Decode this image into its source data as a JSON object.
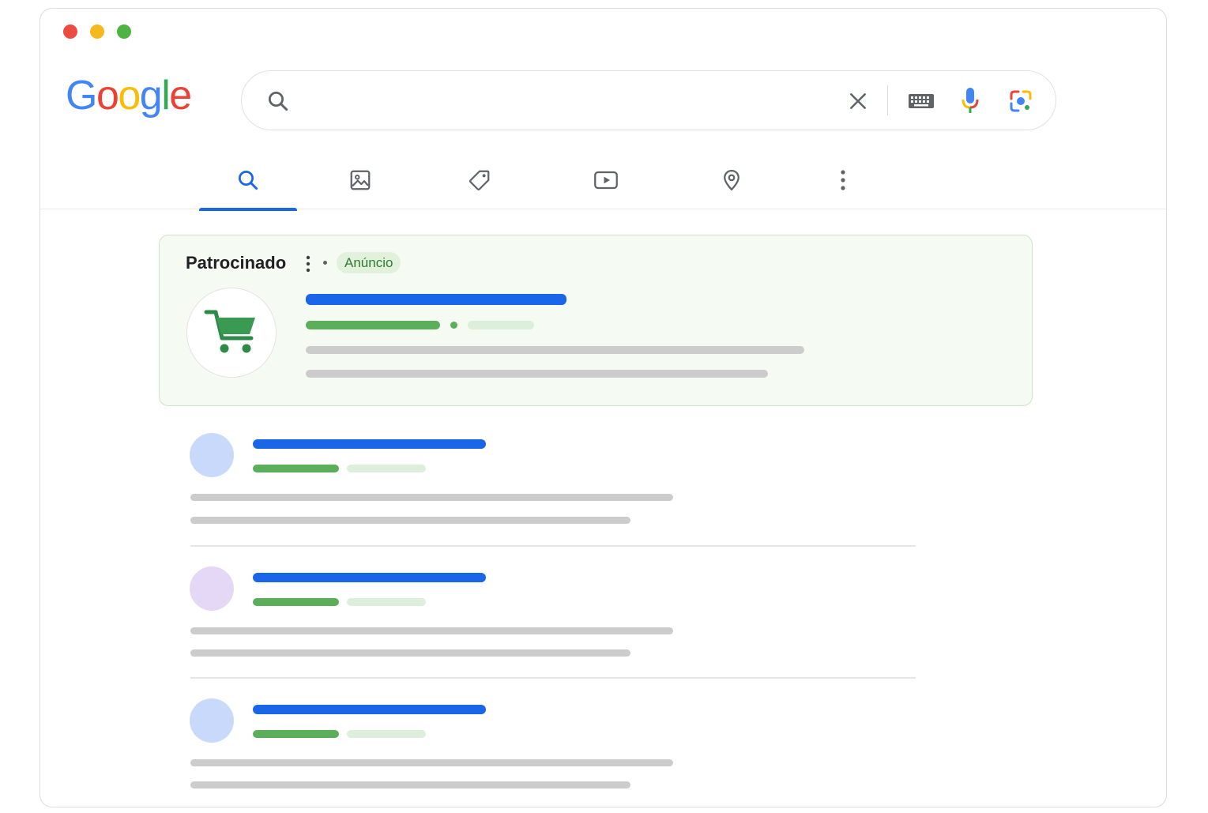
{
  "window": {
    "controls": [
      "close",
      "minimize",
      "maximize"
    ]
  },
  "logo": {
    "letters": [
      "G",
      "o",
      "o",
      "g",
      "l",
      "e"
    ]
  },
  "search": {
    "value": "",
    "placeholder": "",
    "icons": [
      "search-icon",
      "clear-icon",
      "keyboard-icon",
      "mic-icon",
      "lens-icon"
    ]
  },
  "tabs": [
    {
      "icon": "search-icon",
      "active": true
    },
    {
      "icon": "image-icon",
      "active": false
    },
    {
      "icon": "tag-icon",
      "active": false
    },
    {
      "icon": "video-icon",
      "active": false
    },
    {
      "icon": "location-pin-icon",
      "active": false
    },
    {
      "icon": "more-vertical-icon",
      "active": false
    }
  ],
  "ad": {
    "sponsored_label": "Patrocinado",
    "badge": "Anúncio",
    "logo_icon": "shopping-cart-icon"
  },
  "results": [
    {
      "favicon_color": "#c9d9fb"
    },
    {
      "favicon_color": "#e5d8f6"
    },
    {
      "favicon_color": "#c9d9fb"
    }
  ],
  "colors": {
    "accent_blue": "#1a66e8",
    "url_green": "#5caf5a",
    "url_green_light": "#dcefda",
    "text_gray": "#cccccc",
    "ad_background": "#f5faf3",
    "ad_border": "#cfe3c9",
    "badge_text": "#2e7d32"
  }
}
